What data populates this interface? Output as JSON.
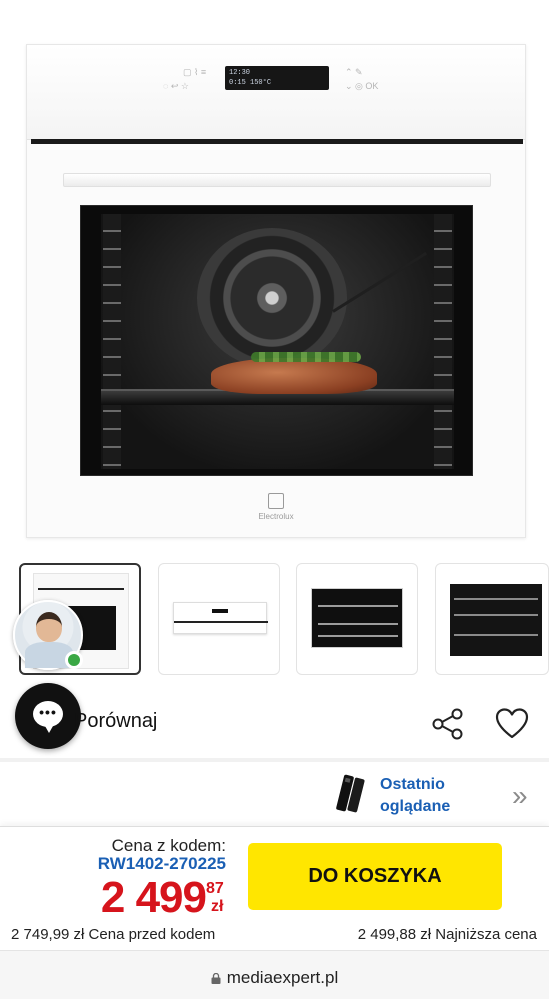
{
  "product": {
    "brand_text": "Electrolux",
    "display_time": "12:30",
    "display_timer": "0:15",
    "display_temp": "150°C",
    "image_alt": "Oven"
  },
  "thumbnails": [
    {
      "label": "Oven front view",
      "active": true
    },
    {
      "label": "Oven top view",
      "active": false
    },
    {
      "label": "Oven interior racks",
      "active": false
    },
    {
      "label": "Oven rack detail",
      "active": false
    }
  ],
  "actions": {
    "compare_label": "Porównaj",
    "share_icon": "share-icon",
    "wishlist_icon": "heart-icon",
    "chat_icon": "chat-icon"
  },
  "recent": {
    "label_line1": "Ostatnio",
    "label_line2": "oglądane",
    "chevron": "»"
  },
  "price": {
    "code_label": "Cena z kodem:",
    "code_value": "RW1402-270225",
    "amount_main": "2 499",
    "amount_cents": "87",
    "currency": "zł",
    "cart_button": "DO KOSZYKA",
    "old_price": "2 749,99 zł  Cena przed kodem",
    "lowest_price": "2 499,88 zł  Najniższa cena"
  },
  "browser": {
    "url": "mediaexpert.pl"
  },
  "colors": {
    "price_red": "#d6141c",
    "code_blue": "#1a5fb4",
    "cart_yellow": "#ffe600",
    "online_green": "#3aa845"
  }
}
